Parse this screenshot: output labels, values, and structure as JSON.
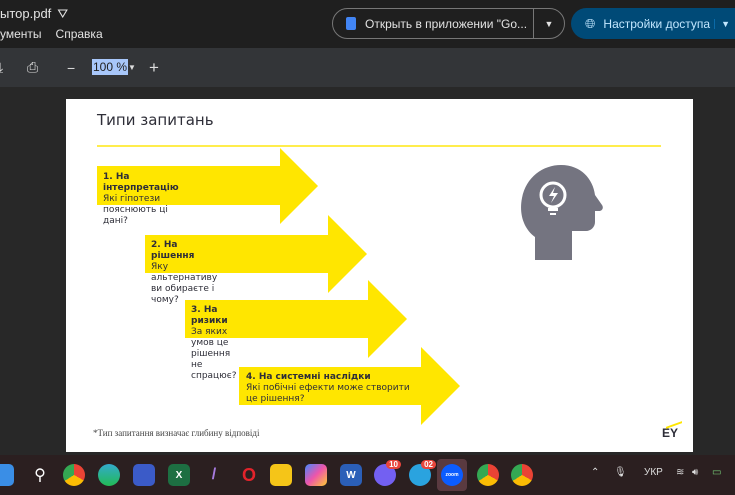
{
  "header": {
    "file_name": "ытор.pdf",
    "menu": [
      "ументы",
      "Справка"
    ],
    "open_button": "Открыть в приложении \"Go...",
    "share_button": "Настройки доступа"
  },
  "toolbar": {
    "zoom": "100 %"
  },
  "slide": {
    "title": "Типи запитань",
    "arrows": [
      {
        "heading": "1. На інтерпретацію",
        "text": "Які гіпотези пояснюють ці дані?"
      },
      {
        "heading": "2.  На рішення",
        "text": "Яку альтернативу ви обираєте і чому?"
      },
      {
        "heading": "3. На ризики",
        "text": "За яких умов це рішення не спрацює?"
      },
      {
        "heading": "4. На системні наслідки",
        "text": "Які побічні ефекти може створити це рішення?"
      }
    ],
    "footnote": "*Тип запитання визначає глибину відповіді",
    "logo": "EY",
    "accent": "#ffe600"
  },
  "taskbar": {
    "viber_badge": "10",
    "telegram_badge": "02",
    "zoom_label": "zoom",
    "language": "УКР"
  }
}
